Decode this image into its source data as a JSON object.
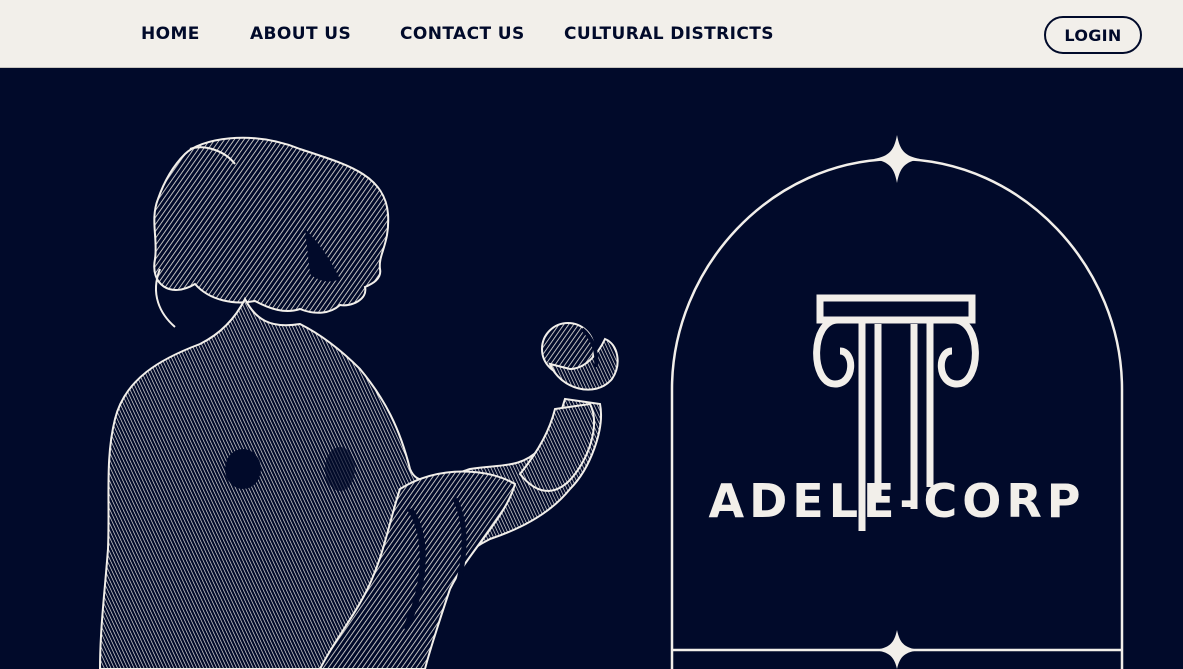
{
  "nav": {
    "links": [
      {
        "label": "HOME"
      },
      {
        "label": "ABOUT US"
      },
      {
        "label": "CONTACT US"
      },
      {
        "label": "CULTURAL DISTRICTS"
      }
    ],
    "login_label": "LOGIN"
  },
  "hero": {
    "brand_name": "ADELE-CORP",
    "logo_icon": "ionic-column-icon",
    "illustration": "engraved-statue-holding-apple"
  },
  "colors": {
    "navy": "#010A2A",
    "cream": "#F2EFEA"
  }
}
